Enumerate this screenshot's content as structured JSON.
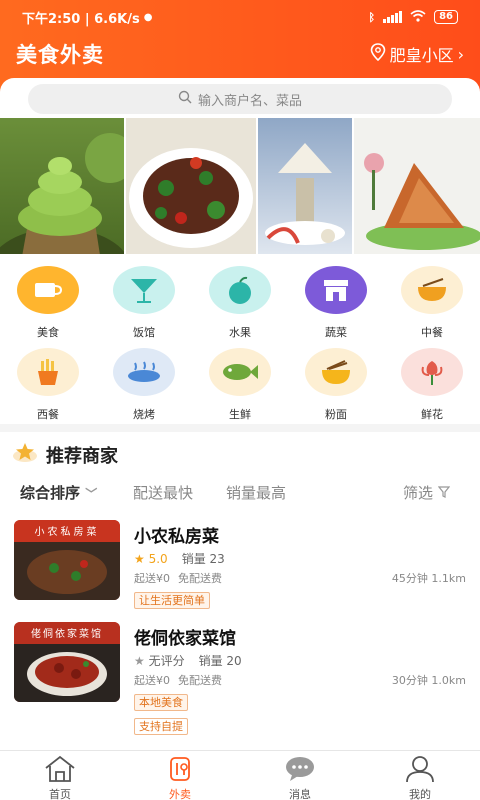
{
  "status_bar": {
    "time_speed": "下午2:50 | 6.6K/s",
    "battery": "86"
  },
  "header": {
    "title": "美食外卖",
    "location": "肥皇小区"
  },
  "search": {
    "placeholder": "输入商户名、菜品"
  },
  "categories": [
    {
      "label": "美食",
      "icon": "cup-icon",
      "bg": "#ffb52e"
    },
    {
      "label": "饭馆",
      "icon": "cocktail-icon",
      "bg": "#c9f1ee"
    },
    {
      "label": "水果",
      "icon": "apple-icon",
      "bg": "#c9f1ee"
    },
    {
      "label": "蔬菜",
      "icon": "store-icon",
      "bg": "#7d5ad9"
    },
    {
      "label": "中餐",
      "icon": "noodle-bowl-icon",
      "bg": "#fdefd3"
    },
    {
      "label": "西餐",
      "icon": "fries-icon",
      "bg": "#fdefd3"
    },
    {
      "label": "烧烤",
      "icon": "bbq-icon",
      "bg": "#dfe9f6"
    },
    {
      "label": "生鲜",
      "icon": "fish-icon",
      "bg": "#fdefd3"
    },
    {
      "label": "粉面",
      "icon": "noodle-icon",
      "bg": "#fdefd3"
    },
    {
      "label": "鲜花",
      "icon": "flower-icon",
      "bg": "#fbe0dc"
    }
  ],
  "recommend": {
    "title": "推荐商家",
    "sort": [
      "综合排序",
      "配送最快",
      "销量最高",
      "筛选"
    ]
  },
  "shops": [
    {
      "image_text": "小农私房菜",
      "name": "小农私房菜",
      "score": "5.0",
      "sales": "销量 23",
      "min_order": "起送¥0",
      "delivery_fee": "免配送费",
      "distance": "45分钟 1.1km",
      "tags": [
        "让生活更简单"
      ]
    },
    {
      "image_text": "佬侗依家菜馆",
      "name": "佬侗依家菜馆",
      "score": "无评分",
      "sales": "销量 20",
      "min_order": "起送¥0",
      "delivery_fee": "免配送费",
      "distance": "30分钟 1.0km",
      "tags": [
        "本地美食",
        "支持自提"
      ]
    }
  ],
  "tabs": [
    {
      "label": "首页",
      "icon": "home-icon"
    },
    {
      "label": "外卖",
      "icon": "takeout-icon"
    },
    {
      "label": "消息",
      "icon": "message-icon"
    },
    {
      "label": "我的",
      "icon": "profile-icon"
    }
  ],
  "colors": {
    "brand": "#ff5a1f",
    "star": "#f3a41c"
  }
}
